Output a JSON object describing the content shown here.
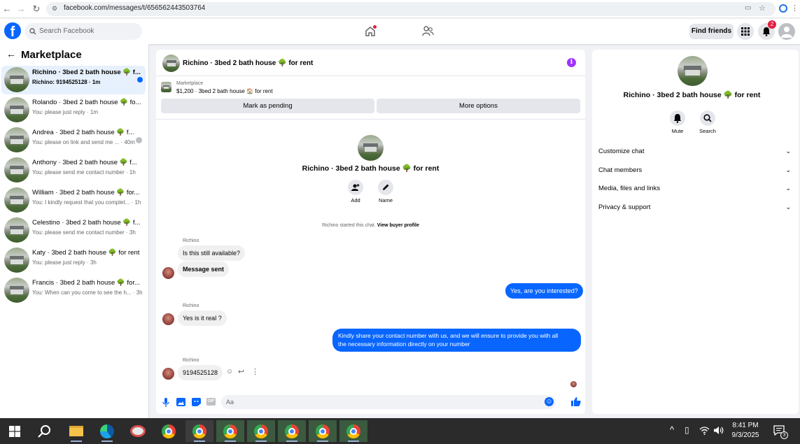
{
  "browser": {
    "url": "facebook.com/messages/t/656562443503764"
  },
  "header": {
    "logo": "f",
    "search_placeholder": "Search Facebook",
    "find_friends": "Find friends",
    "notifications_count": "2"
  },
  "left": {
    "title": "Marketplace",
    "conversations": [
      {
        "name": "Richino · 3bed 2 bath house 🌳 f...",
        "preview": "Richino: 9194525128 · 1m"
      },
      {
        "name": "Rolando · 3bed 2 bath house 🌳 fo...",
        "preview": "You: please just reply · 1m"
      },
      {
        "name": "Andrea · 3bed 2 bath house 🌳 f...",
        "preview": "You: please on link and send me ... · 40m"
      },
      {
        "name": "Anthony · 3bed 2 bath house 🌳 f...",
        "preview": "You: please send me contact number · 1h"
      },
      {
        "name": "William · 3bed 2 bath house 🌳 for...",
        "preview": "You: I kindly request that you complet... · 1h"
      },
      {
        "name": "Celestino · 3bed 2 bath house 🌳 f...",
        "preview": "You: please send me contact number · 3h"
      },
      {
        "name": "Katy · 3bed 2 bath house 🌳 for rent",
        "preview": "You: please just reply · 3h"
      },
      {
        "name": "Francis · 3bed 2 bath house 🌳 for...",
        "preview": "You: When can you come to see the h... · 3h"
      }
    ]
  },
  "chat": {
    "title": "Richino · 3bed 2 bath house 🌳 for rent",
    "listing_category": "Marketplace",
    "listing_desc": "$1,200 · 3bed 2 bath house 🏠 for rent",
    "mark_pending": "Mark as pending",
    "more_options": "More options",
    "profile_name": "Richino · 3bed 2 bath house 🌳 for rent",
    "add_label": "Add",
    "name_label": "Name",
    "started_note": "Richino started this chat.",
    "view_buyer": "View buyer profile",
    "messages": {
      "sender1": "Richino",
      "m1": "Is this still available?",
      "m2": "Message sent",
      "m3": "Yes, are you interested?",
      "sender2": "Richino",
      "m4": "Yes is it real ?",
      "m5_line1": "Kindly share your contact number with us, and we will ensure to provide you with all",
      "m5_line2": "the necessary information directly on your number",
      "sender3": "Richino",
      "m6": "9194525128"
    },
    "composer_placeholder": "Aa"
  },
  "right": {
    "name": "Richino · 3bed 2 bath house 🌳 for rent",
    "mute": "Mute",
    "search": "Search",
    "sections": [
      "Customize chat",
      "Chat members",
      "Media, files and links",
      "Privacy & support"
    ]
  },
  "taskbar": {
    "time": "8:41 PM",
    "date": "9/3/2025",
    "notif_count": "3"
  },
  "colors": {
    "accent": "#0866ff",
    "info": "#a033ff"
  }
}
